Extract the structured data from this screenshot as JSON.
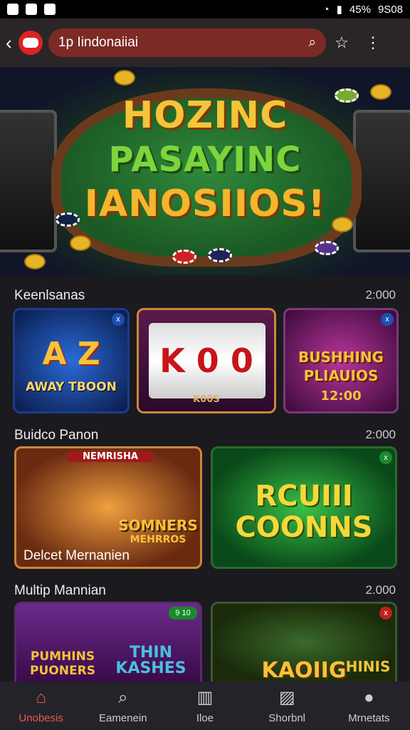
{
  "status_bar": {
    "time": "9S08",
    "battery": "45%"
  },
  "header": {
    "search_text": "1p Iindonaiiai"
  },
  "hero": {
    "line1": "HOZINC",
    "line2": "PASAYINC",
    "line3": "IANOSIIOS!"
  },
  "sections": [
    {
      "title": "Keenlsanas",
      "count": "2:000",
      "cards": [
        {
          "line1": "A Z",
          "line2": "AWAY TBOON"
        },
        {
          "line1": "K 0 0",
          "line2": "K00S"
        },
        {
          "line1": "BUSHHING",
          "line2": "PLIAUIOS",
          "line3": "12:00"
        }
      ]
    },
    {
      "title": "Buidco Panon",
      "count": "2:000",
      "cards": [
        {
          "line1": "NEMRISHA",
          "line2": "SOMNERS",
          "line3": "MEHRROS",
          "caption": "Delcet Mernanien"
        },
        {
          "line1": "RCUIII",
          "line2": "COONNS"
        }
      ]
    },
    {
      "title": "Multip Mannian",
      "count": "2.000",
      "cards": [
        {
          "line1": "PUMHINS",
          "line2": "PUONERS",
          "line3": "THIN",
          "line4": "KASHES",
          "badge": "9 10"
        },
        {
          "line1": "KAOIIG",
          "line2": "HINIS"
        }
      ]
    }
  ],
  "nav": [
    {
      "label": "Unobesis",
      "icon": "home-icon"
    },
    {
      "label": "Eamenein",
      "icon": "search-icon"
    },
    {
      "label": "Iloe",
      "icon": "chart-icon"
    },
    {
      "label": "Shorbnl",
      "icon": "image-icon"
    },
    {
      "label": "Mrnetats",
      "icon": "user-icon"
    }
  ]
}
